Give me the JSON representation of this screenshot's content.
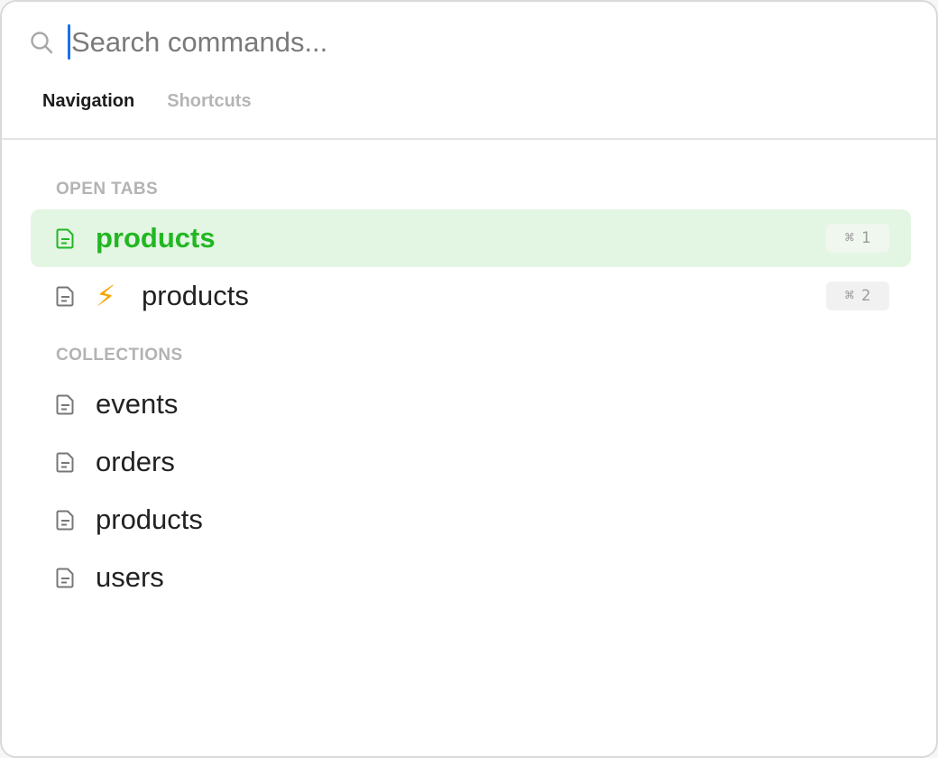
{
  "search": {
    "placeholder": "Search commands...",
    "value": ""
  },
  "tabs": [
    {
      "label": "Navigation",
      "active": true
    },
    {
      "label": "Shortcuts",
      "active": false
    }
  ],
  "sections": {
    "open_tabs": {
      "label": "OPEN TABS",
      "items": [
        {
          "label": "products",
          "icon": "document-icon",
          "selected": true,
          "shortcut_key": "⌘",
          "shortcut_num": "1"
        },
        {
          "label": "products",
          "icon": "document-icon",
          "badge_icon": "lightning-bolt-icon",
          "badge_glyph": "⚡",
          "selected": false,
          "shortcut_key": "⌘",
          "shortcut_num": "2"
        }
      ]
    },
    "collections": {
      "label": "COLLECTIONS",
      "items": [
        {
          "label": "events",
          "icon": "document-icon"
        },
        {
          "label": "orders",
          "icon": "document-icon"
        },
        {
          "label": "products",
          "icon": "document-icon"
        },
        {
          "label": "users",
          "icon": "document-icon"
        }
      ]
    }
  },
  "colors": {
    "selected_bg": "#e3f6e3",
    "selected_text": "#22b722",
    "caret": "#1a73e8",
    "bolt": "#f4a500"
  }
}
